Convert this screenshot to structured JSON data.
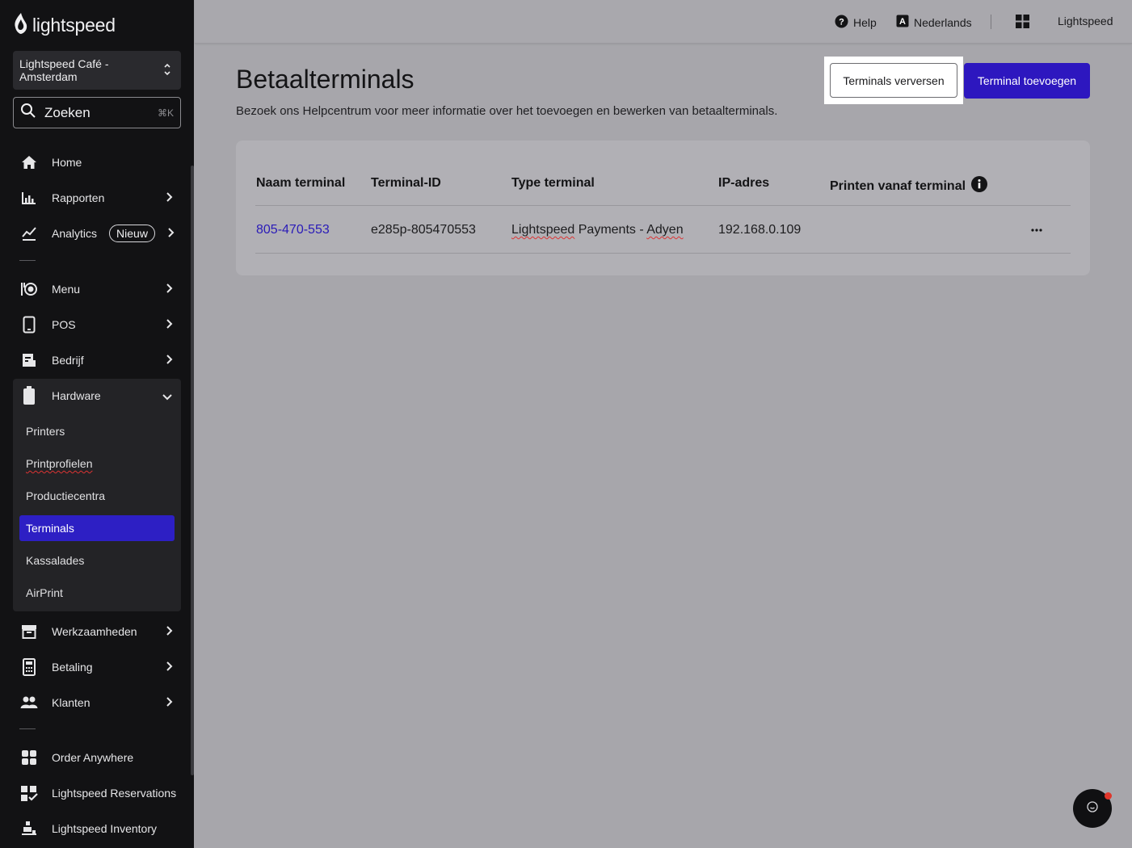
{
  "sidebar": {
    "brand": "lightspeed",
    "store": {
      "name": "Lightspeed Café - Amsterdam"
    },
    "search": {
      "label": "Zoeken",
      "shortcut": "⌘K"
    },
    "items": {
      "home": "Home",
      "rapporten": "Rapporten",
      "analytics": "Analytics",
      "analytics_badge": "Nieuw",
      "menu": "Menu",
      "pos": "POS",
      "bedrijf": "Bedrijf",
      "hardware": "Hardware",
      "werkzaamheden": "Werkzaamheden",
      "betaling": "Betaling",
      "klanten": "Klanten",
      "order_anywhere": "Order Anywhere",
      "reservations": "Lightspeed Reservations",
      "inventory": "Lightspeed Inventory"
    },
    "hardware_sub": {
      "printers": "Printers",
      "printprofielen": "Printprofielen",
      "productiecentra": "Productiecentra",
      "terminals": "Terminals",
      "kassalades": "Kassalades",
      "airprint": "AirPrint"
    }
  },
  "topbar": {
    "help": "Help",
    "language": "Nederlands",
    "account": "Lightspeed"
  },
  "main": {
    "title": "Betaalterminals",
    "subtitle": "Bezoek ons Helpcentrum voor meer informatie over het toevoegen en bewerken van betaalterminals.",
    "refresh_button": "Terminals verversen",
    "add_button": "Terminal toevoegen",
    "table": {
      "headers": {
        "name": "Naam terminal",
        "id": "Terminal-ID",
        "type": "Type terminal",
        "ip": "IP-adres",
        "print": "Printen vanaf terminal"
      },
      "rows": [
        {
          "name": "805-470-553",
          "id": "e285p-805470553",
          "type_brand": "Lightspeed",
          "type_rest": " Payments - ",
          "type_provider": "Adyen",
          "ip": "192.168.0.109",
          "print": ""
        }
      ]
    }
  },
  "colors": {
    "accent": "#2d17bf",
    "sidebar_bg": "#121214",
    "active_item": "#2d1fc4",
    "overlay_bg": "#a7a6ab"
  }
}
